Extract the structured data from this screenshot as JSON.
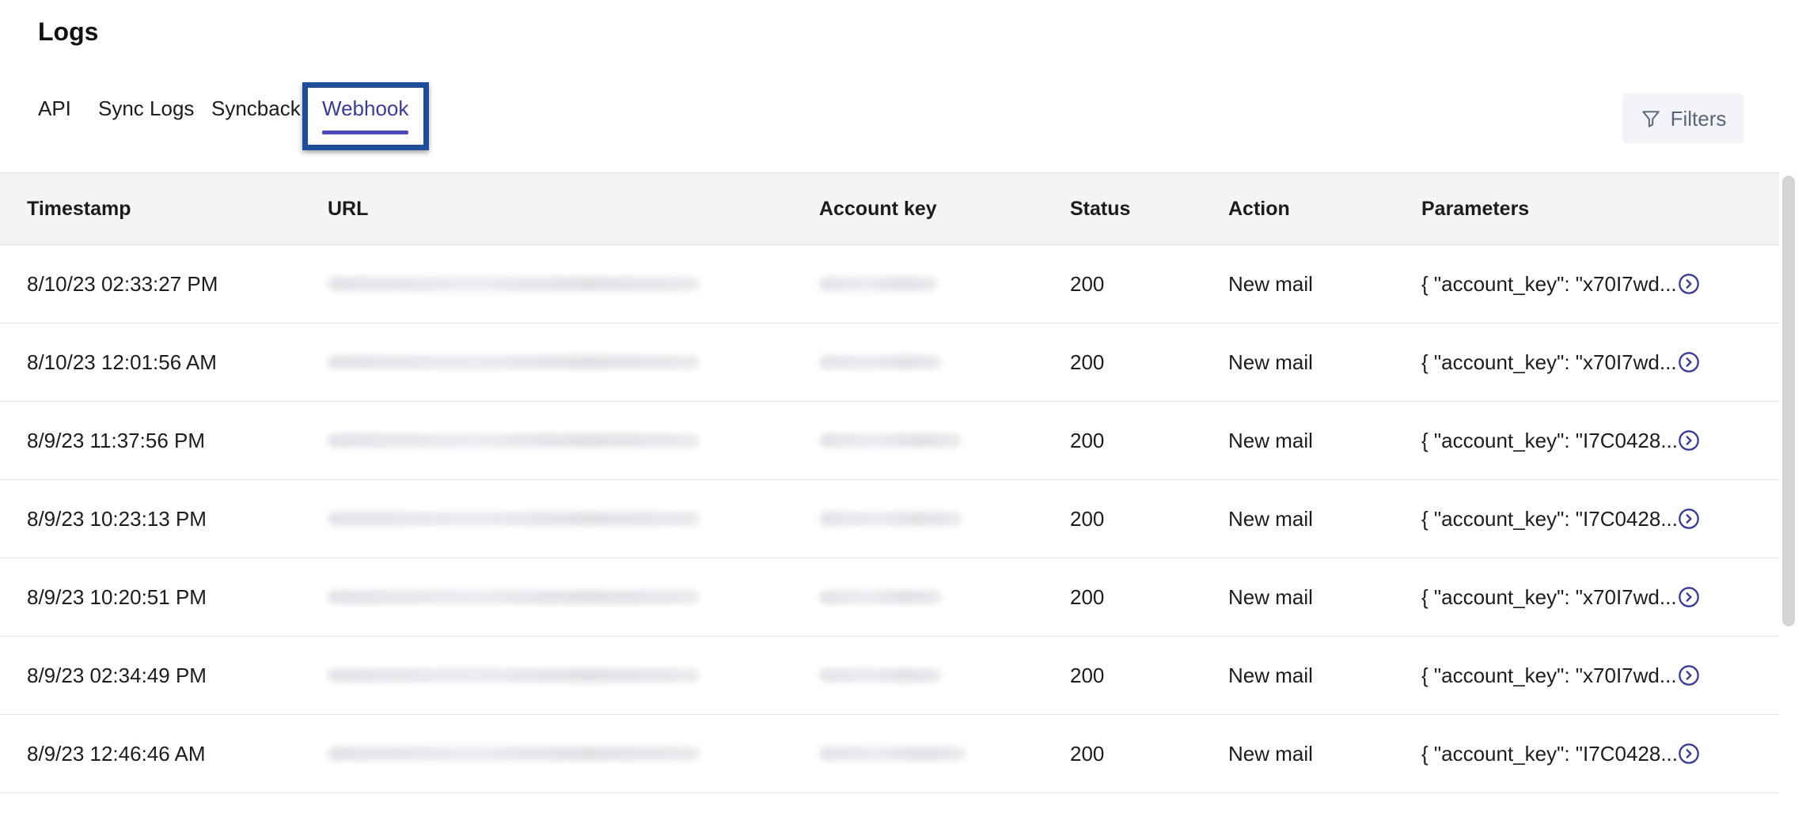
{
  "page": {
    "title": "Logs"
  },
  "tabs": [
    {
      "label": "API"
    },
    {
      "label": "Sync Logs"
    },
    {
      "label": "Syncback"
    },
    {
      "label": "Webhook",
      "active": true
    }
  ],
  "filters": {
    "label": "Filters",
    "icon": "filter-icon"
  },
  "table": {
    "columns": [
      "Timestamp",
      "URL",
      "Account key",
      "Status",
      "Action",
      "Parameters"
    ],
    "rows": [
      {
        "timestamp": "8/10/23 02:33:27 PM",
        "status": "200",
        "action": "New mail",
        "parameters": "{ \"account_key\": \"x70I7wd...",
        "row_icon": "chevron-right-circle-icon"
      },
      {
        "timestamp": "8/10/23 12:01:56 AM",
        "status": "200",
        "action": "New mail",
        "parameters": "{ \"account_key\": \"x70I7wd...",
        "row_icon": "chevron-right-circle-icon"
      },
      {
        "timestamp": "8/9/23 11:37:56 PM",
        "status": "200",
        "action": "New mail",
        "parameters": "{ \"account_key\": \"I7C0428...",
        "row_icon": "chevron-right-circle-icon"
      },
      {
        "timestamp": "8/9/23 10:23:13 PM",
        "status": "200",
        "action": "New mail",
        "parameters": "{ \"account_key\": \"I7C0428...",
        "row_icon": "chevron-right-circle-icon"
      },
      {
        "timestamp": "8/9/23 10:20:51 PM",
        "status": "200",
        "action": "New mail",
        "parameters": "{ \"account_key\": \"x70I7wd...",
        "row_icon": "chevron-right-circle-icon"
      },
      {
        "timestamp": "8/9/23 02:34:49 PM",
        "status": "200",
        "action": "New mail",
        "parameters": "{ \"account_key\": \"x70I7wd...",
        "row_icon": "chevron-right-circle-icon"
      },
      {
        "timestamp": "8/9/23 12:46:46 AM",
        "status": "200",
        "action": "New mail",
        "parameters": "{ \"account_key\": \"I7C0428...",
        "row_icon": "chevron-right-circle-icon"
      }
    ]
  },
  "colors": {
    "accent": "#4b48b8",
    "highlight_border": "#1e4d9a",
    "header_bg": "#f4f4f4",
    "filters_bg": "#f3f4f8"
  }
}
